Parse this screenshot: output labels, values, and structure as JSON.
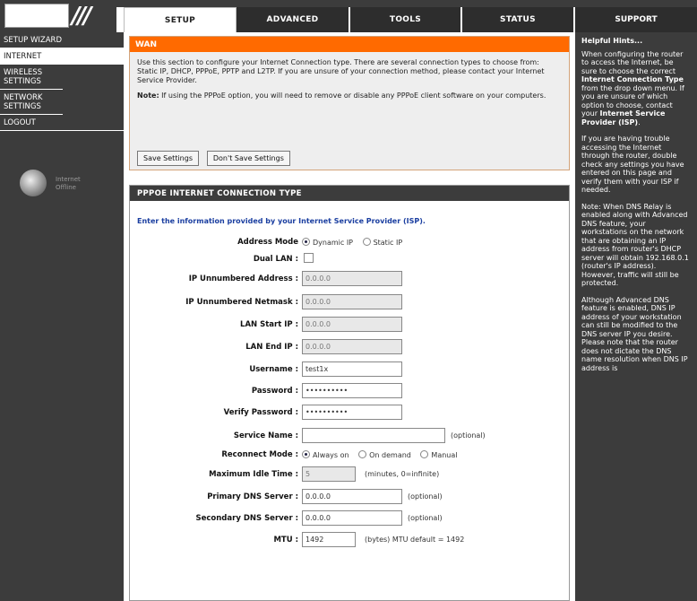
{
  "tabs": {
    "setup": "SETUP",
    "advanced": "ADVANCED",
    "tools": "TOOLS",
    "status": "STATUS",
    "support": "SUPPORT"
  },
  "sidebar": {
    "items": [
      "SETUP WIZARD",
      "INTERNET",
      "WIRELESS SETTINGS",
      "NETWORK SETTINGS",
      "LOGOUT"
    ],
    "badge_line1": "Internet",
    "badge_line2": "Offline"
  },
  "wan": {
    "title": "WAN",
    "description": "Use this section to configure your Internet Connection type. There are several connection types to choose from: Static IP, DHCP, PPPoE, PPTP and L2TP. If you are unsure of your connection method, please contact your Internet Service Provider.",
    "note_label": "Note:",
    "note_text": " If using the PPPoE option, you will need to remove or disable any PPPoE client software on your computers.",
    "save_label": "Save Settings",
    "dont_save_label": "Don't Save Settings"
  },
  "pppoe": {
    "title": "PPPOE INTERNET CONNECTION TYPE",
    "intro": "Enter the information provided by your Internet Service Provider (ISP).",
    "address_mode_label": "Address Mode",
    "address_mode_options": [
      "Dynamic IP",
      "Static IP"
    ],
    "dual_lan_label": "Dual LAN :",
    "ip_unnumbered_address_label": "IP Unnumbered Address :",
    "ip_unnumbered_address_value": "0.0.0.0",
    "ip_unnumbered_netmask_label": "IP Unnumbered Netmask :",
    "ip_unnumbered_netmask_value": "0.0.0.0",
    "lan_start_ip_label": "LAN Start IP :",
    "lan_start_ip_value": "0.0.0.0",
    "lan_end_ip_label": "LAN End IP :",
    "lan_end_ip_value": "0.0.0.0",
    "username_label": "Username :",
    "username_value": "test1x",
    "password_label": "Password :",
    "password_value": "••••••••••",
    "verify_password_label": "Verify Password :",
    "verify_password_value": "••••••••••",
    "service_name_label": "Service Name :",
    "service_name_value": "",
    "service_name_hint": "(optional)",
    "reconnect_mode_label": "Reconnect Mode :",
    "reconnect_options": [
      "Always on",
      "On demand",
      "Manual"
    ],
    "max_idle_label": "Maximum Idle Time :",
    "max_idle_value": "5",
    "max_idle_hint": "(minutes, 0=infinite)",
    "primary_dns_label": "Primary DNS Server :",
    "primary_dns_value": "0.0.0.0",
    "primary_dns_hint": "(optional)",
    "secondary_dns_label": "Secondary DNS Server :",
    "secondary_dns_value": "0.0.0.0",
    "secondary_dns_hint": "(optional)",
    "mtu_label": "MTU :",
    "mtu_value": "1492",
    "mtu_hint": "(bytes) MTU default = 1492"
  },
  "hints": {
    "title": "Helpful Hints...",
    "p1_a": "When configuring the router to access the Internet, be sure to choose the correct ",
    "p1_b": "Internet Connection Type",
    "p1_c": " from the drop down menu. If you are unsure of which option to choose, contact your ",
    "p1_d": "Internet Service Provider (ISP)",
    "p1_e": ".",
    "p2": "If you are having trouble accessing the Internet through the router, double check any settings you have entered on this page and verify them with your ISP if needed.",
    "p3": "Note: When DNS Relay is enabled along with Advanced DNS feature, your workstations on the network that are obtaining an IP address from router's DHCP server will obtain 192.168.0.1 (router's IP address). However, traffic will still be protected.",
    "p4": "Although Advanced DNS feature is enabled, DNS IP address of your workstation can still be modified to the DNS server IP you desire. Please note that the router does not dictate the DNS name resolution when DNS IP address is"
  }
}
